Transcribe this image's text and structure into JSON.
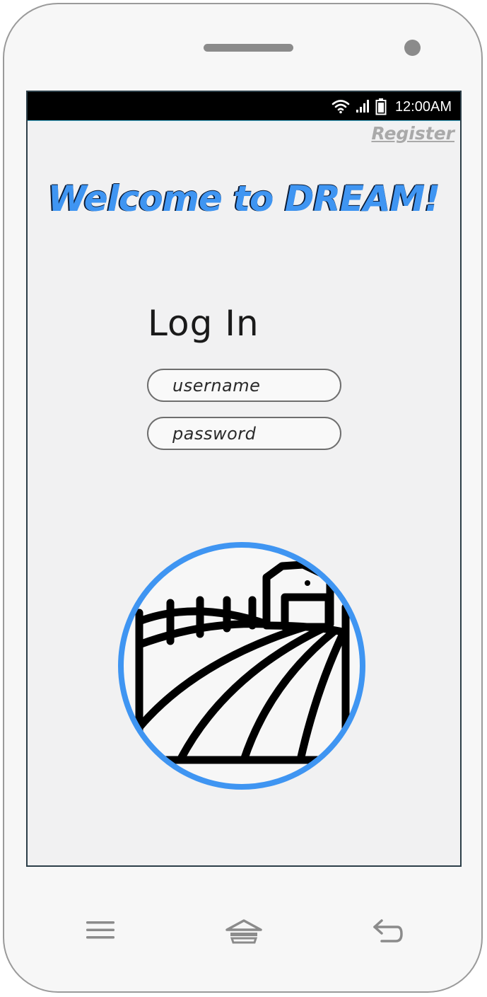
{
  "status_bar": {
    "time": "12:00AM",
    "icons": [
      "wifi-icon",
      "signal-icon",
      "battery-icon"
    ]
  },
  "header": {
    "register_label": "Register"
  },
  "main": {
    "welcome_title": "Welcome to DREAM!",
    "login_title": "Log In",
    "username_placeholder": "username",
    "password_placeholder": "password",
    "logo_icon": "farm-field-icon"
  },
  "nav_bar": {
    "icons": [
      "menu-icon",
      "home-icon",
      "back-icon"
    ]
  },
  "colors": {
    "accent": "#3f95f2",
    "screen_bg": "#f1f1f2",
    "link_gray": "#a9a9a9"
  }
}
